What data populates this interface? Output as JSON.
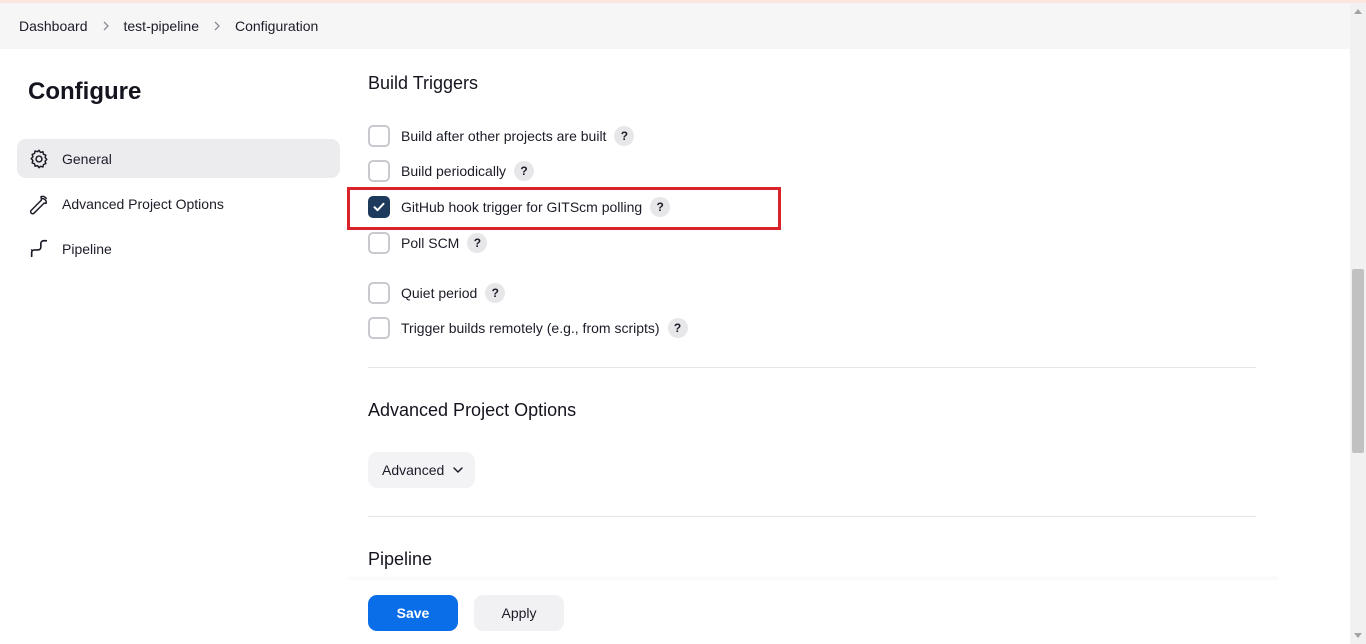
{
  "breadcrumb": {
    "items": [
      "Dashboard",
      "test-pipeline",
      "Configuration"
    ]
  },
  "sidebar": {
    "title": "Configure",
    "items": [
      {
        "label": "General",
        "icon": "gear-icon",
        "active": true
      },
      {
        "label": "Advanced Project Options",
        "icon": "wrench-icon",
        "active": false
      },
      {
        "label": "Pipeline",
        "icon": "pipeline-icon",
        "active": false
      }
    ]
  },
  "build_triggers": {
    "title": "Build Triggers",
    "options": [
      {
        "label": "Build after other projects are built",
        "checked": false
      },
      {
        "label": "Build periodically",
        "checked": false
      },
      {
        "label": "GitHub hook trigger for GITScm polling",
        "checked": true
      },
      {
        "label": "Poll SCM",
        "checked": false
      },
      {
        "label": "Quiet period",
        "checked": false
      },
      {
        "label": "Trigger builds remotely (e.g., from scripts)",
        "checked": false
      }
    ],
    "help_label": "?"
  },
  "advanced_options": {
    "title": "Advanced Project Options",
    "button_label": "Advanced"
  },
  "pipeline": {
    "title": "Pipeline"
  },
  "actions": {
    "save_label": "Save",
    "apply_label": "Apply"
  },
  "colors": {
    "primary": "#0a6ee8",
    "checkbox_checked": "#1d3a5c",
    "highlight": "#d8232a"
  }
}
